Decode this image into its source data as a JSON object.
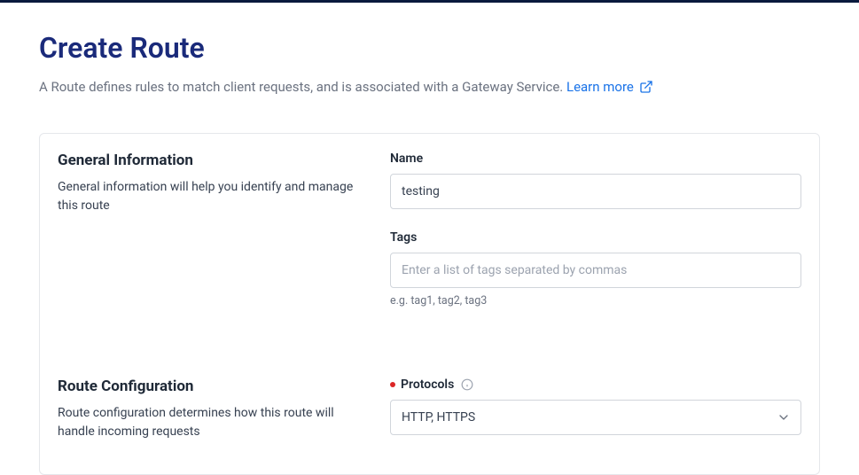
{
  "header": {
    "title": "Create Route",
    "subtitle": "A Route defines rules to match client requests, and is associated with a Gateway Service. ",
    "learn_more": "Learn more"
  },
  "sections": {
    "general": {
      "title": "General Information",
      "description": "General information will help you identify and manage this route"
    },
    "config": {
      "title": "Route Configuration",
      "description": "Route configuration determines how this route will handle incoming requests"
    }
  },
  "fields": {
    "name": {
      "label": "Name",
      "value": "testing"
    },
    "tags": {
      "label": "Tags",
      "value": "",
      "placeholder": "Enter a list of tags separated by commas",
      "helper": "e.g. tag1, tag2, tag3"
    },
    "protocols": {
      "label": "Protocols",
      "selected": "HTTP, HTTPS"
    }
  }
}
